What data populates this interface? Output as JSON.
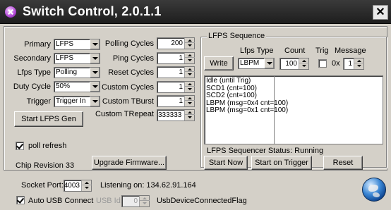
{
  "window": {
    "title": "Switch Control, 2.0.1.1",
    "close_label": "✕"
  },
  "left": {
    "primary": {
      "label": "Primary",
      "value": "LFPS"
    },
    "secondary": {
      "label": "Secondary",
      "value": "LFPS"
    },
    "lfps_type": {
      "label": "Lfps Type",
      "value": "Polling"
    },
    "duty_cycle": {
      "label": "Duty Cycle",
      "value": "50%"
    },
    "trigger": {
      "label": "Trigger",
      "value": "Trigger In"
    },
    "start_button": "Start LFPS Gen",
    "poll_refresh": {
      "label": "poll refresh",
      "checked": true
    },
    "chip_revision": "Chip Revision 33"
  },
  "cycles": {
    "polling": {
      "label": "Polling Cycles",
      "value": "200"
    },
    "ping": {
      "label": "Ping Cycles",
      "value": "1"
    },
    "reset": {
      "label": "Reset Cycles",
      "value": "1"
    },
    "custom": {
      "label": "Custom Cycles",
      "value": "1"
    },
    "tburst": {
      "label": "Custom TBurst",
      "value": "1"
    },
    "trepeat": {
      "label": "Custom TRepeat",
      "value": "333333"
    },
    "upgrade_button": "Upgrade Firmware..."
  },
  "sequence": {
    "group_title": "LFPS Sequence",
    "col_lfps_type": "Lfps Type",
    "col_count": "Count",
    "col_trig": "Trig",
    "col_message": "Message",
    "write_button": "Write",
    "type_value": "LBPM",
    "count_value": "100",
    "trig_checked": false,
    "message_prefix": "0x",
    "message_value": "1",
    "items": [
      "Idle (until Trig)",
      "SCD1 (cnt=100)",
      "SCD2 (cnt=100)",
      "LBPM (msg=0x4 cnt=100)",
      "LBPM (msg=0x1 cnt=100)"
    ],
    "status": "LFPS Sequencer Status: Running",
    "start_now": "Start Now",
    "start_on_trigger": "Start on Trigger",
    "reset": "Reset"
  },
  "bottom": {
    "socket_port_label": "Socket Port:",
    "socket_port_value": "4003",
    "listening": "Listening on: 134.62.91.164",
    "auto_usb_label": "Auto USB Connect",
    "auto_usb_checked": true,
    "usb_id_label": "USB Id:",
    "usb_id_value": "0",
    "usb_flag": "UsbDeviceConnectedFlag",
    "globe_icon": "globe-icon"
  }
}
